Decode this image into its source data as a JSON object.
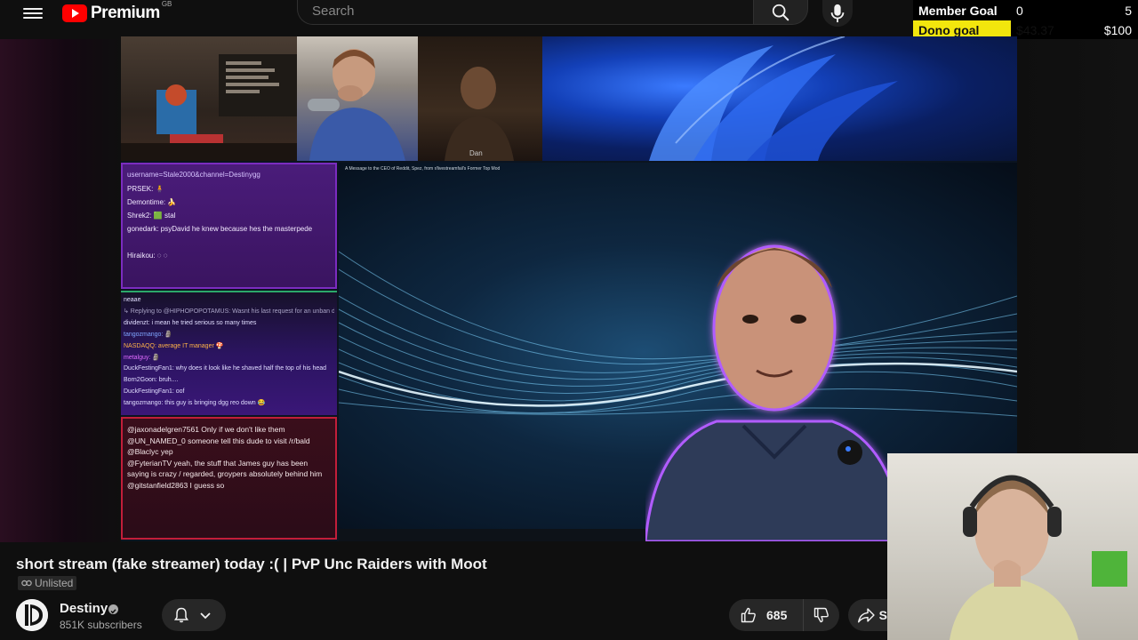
{
  "header": {
    "logo_text": "Premium",
    "logo_region": "GB",
    "search_placeholder": "Search"
  },
  "goals": {
    "member": {
      "label": "Member Goal",
      "current": "0",
      "target": "5",
      "progress": 0.0
    },
    "dono": {
      "label": "Dono goal",
      "current": "$43.37",
      "target": "$100",
      "progress": 0.434
    }
  },
  "video": {
    "cam_label": "Dan",
    "desktop_title": "A Message to the CEO of Reddit, Spez, from r/livestreamfail's Former Top Mod",
    "chat_top": {
      "header": "username=Stale2000&channel=Destinygg",
      "lines": [
        "PRSEK: 🧍",
        "Demontime: 🍌",
        "Shrek2: 🟩 stal",
        "gonedark: psyDavid he knew because hes the masterpede",
        "",
        "Hiraikou: ◌ ◌"
      ]
    },
    "chat_mid": {
      "lines": [
        "neaae",
        "↳ Replying to @HIPHOPOPOTAMUS: Wasnt his last request for an unban done",
        "dividenzt: i mean he tried serious so many times",
        "tangozmango: 🗿",
        "NASDAQQ: average IT manager 🍄",
        "metalguy: 🗿",
        "DuckFestingFan1: why does it look like he shaved half the top of his head",
        "Born2Goon: bruh....",
        "DuckFestingFan1: oof",
        "tangozmango: this guy is bringing dgg reo down 😂"
      ]
    },
    "chat_bot": {
      "lines": [
        "@jaxonadelgren7561 Only if we don't like them",
        "@UN_NAMED_0 someone tell this dude to visit /r/bald",
        "@Blaclyc yep",
        "@FyterianTV yeah, the stuff that James guy has been saying is crazy / regarded, groypers absolutely behind him",
        "@gitstanfield2863 I guess so"
      ]
    }
  },
  "info": {
    "title": "short stream (fake streamer) today :( | PvP Unc Raiders with Moot",
    "visibility": "Unlisted",
    "channel_name": "Destiny",
    "subscribers": "851K subscribers",
    "likes": "685",
    "share_label": "S"
  },
  "icons": {
    "menu": "hamburger-icon",
    "search": "search-icon",
    "mic": "mic-icon",
    "bell": "bell-icon",
    "chevron": "chevron-down-icon",
    "like": "thumbs-up-icon",
    "dislike": "thumbs-down-icon",
    "share": "share-icon",
    "link": "link-icon",
    "verified": "verified-check-icon"
  },
  "colors": {
    "background": "#0f0f0f",
    "brand_red": "#ff0000",
    "goal_fill": "#f2e60d",
    "chat_top_border": "#7b2cc0",
    "chat_bot_border": "#c21e3a"
  }
}
